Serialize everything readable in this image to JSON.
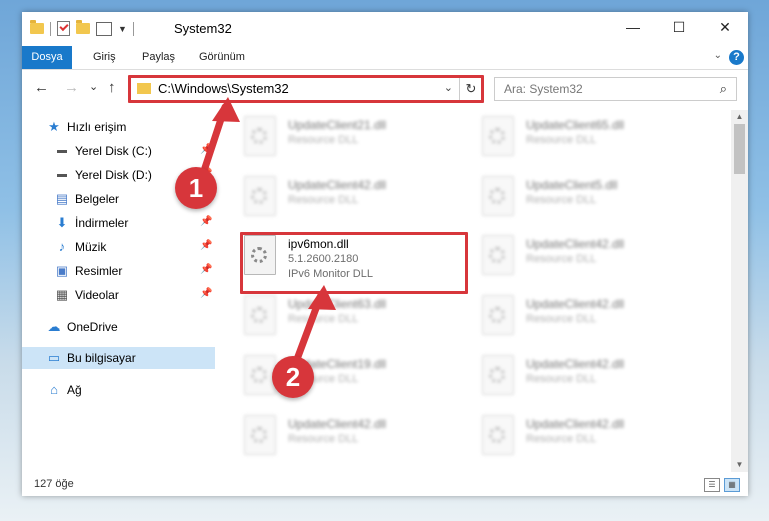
{
  "window": {
    "title": "System32",
    "minimize": "—",
    "maximize": "☐",
    "close": "✕"
  },
  "ribbon": {
    "tabs": [
      "Dosya",
      "Giriş",
      "Paylaş",
      "Görünüm"
    ],
    "help": "?"
  },
  "nav": {
    "back": "←",
    "forward": "→",
    "recent": "⌄",
    "up": "↑",
    "address": "C:\\Windows\\System32",
    "refresh": "↻",
    "search_placeholder": "Ara: System32",
    "search_icon": "⌕"
  },
  "sidebar": {
    "items": [
      {
        "label": "Hızlı erişim",
        "icon": "star-icon",
        "pinned": false
      },
      {
        "label": "Yerel Disk (C:)",
        "icon": "drive-icon",
        "pinned": true
      },
      {
        "label": "Yerel Disk (D:)",
        "icon": "drive-icon",
        "pinned": true
      },
      {
        "label": "Belgeler",
        "icon": "documents-icon",
        "pinned": true
      },
      {
        "label": "İndirmeler",
        "icon": "download-icon",
        "pinned": true
      },
      {
        "label": "Müzik",
        "icon": "music-icon",
        "pinned": true
      },
      {
        "label": "Resimler",
        "icon": "pictures-icon",
        "pinned": true
      },
      {
        "label": "Videolar",
        "icon": "videos-icon",
        "pinned": true
      },
      {
        "label": "OneDrive",
        "icon": "cloud-icon",
        "pinned": false
      },
      {
        "label": "Bu bilgisayar",
        "icon": "computer-icon",
        "pinned": false,
        "selected": true
      },
      {
        "label": "Ağ",
        "icon": "network-icon",
        "pinned": false
      }
    ]
  },
  "files": {
    "left": [
      {
        "name": "UpdateClient21.dll",
        "type": "Resource DLL"
      },
      {
        "name": "UpdateClient42.dll",
        "type": "Resource DLL"
      },
      {
        "name": "ipv6mon.dll",
        "version": "5.1.2600.2180",
        "type": "IPv6 Monitor DLL",
        "highlighted": true
      },
      {
        "name": "UpdateClient63.dll",
        "type": "Resource DLL"
      },
      {
        "name": "UpdateClient19.dll",
        "type": "Resource DLL"
      },
      {
        "name": "UpdateClient42.dll",
        "type": "Resource DLL"
      }
    ],
    "right": [
      {
        "name": "UpdateClient65.dll",
        "type": "Resource DLL"
      },
      {
        "name": "UpdateClient5.dll",
        "type": "Resource DLL"
      },
      {
        "name": "UpdateClient42.dll",
        "type": "Resource DLL"
      },
      {
        "name": "UpdateClient42.dll",
        "type": "Resource DLL"
      },
      {
        "name": "UpdateClient42.dll",
        "type": "Resource DLL"
      },
      {
        "name": "UpdateClient42.dll",
        "type": "Resource DLL"
      }
    ]
  },
  "status": {
    "count": "127 öğe"
  },
  "annotations": {
    "step1": "1",
    "step2": "2",
    "color": "#d7363b"
  }
}
